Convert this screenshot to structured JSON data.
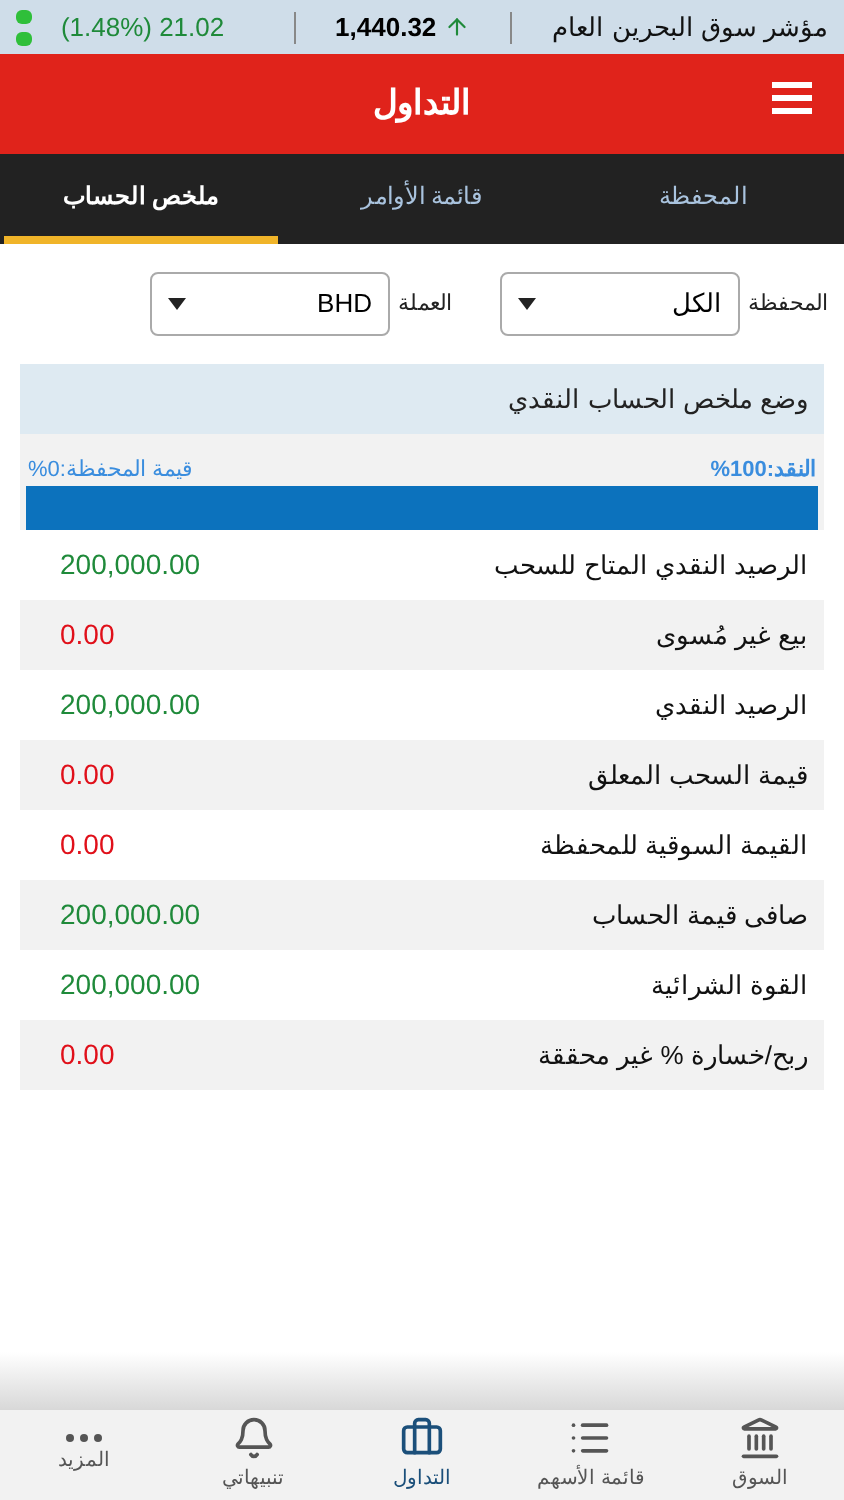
{
  "ticker": {
    "index_name": "مؤشر سوق البحرين العام",
    "value": "1,440.32",
    "up": true,
    "change": "(1.48%) 21.02"
  },
  "header": {
    "title": "التداول"
  },
  "tabs": [
    {
      "label": "المحفظة",
      "selected": false
    },
    {
      "label": "قائمة الأوامر",
      "selected": false
    },
    {
      "label": "ملخص الحساب",
      "selected": true
    }
  ],
  "filters": [
    {
      "label": "المحفظة",
      "value": "الكل"
    },
    {
      "label": "العملة",
      "value": "BHD"
    }
  ],
  "summary": {
    "title": "وضع ملخص الحساب النقدي",
    "cash_label": "النقد:100%",
    "portfolio_label": "قيمة المحفظة:0%",
    "level": 1
  },
  "rows": [
    {
      "label": "الرصيد النقدي المتاح للسحب",
      "value": "200,000.00",
      "color": "#1f8a3a"
    },
    {
      "label": "بيع غير مُسوى",
      "value": "0.00",
      "color": "#e0101a"
    },
    {
      "label": "الرصيد النقدي",
      "value": "200,000.00",
      "color": "#1f8a3a"
    },
    {
      "label": "قيمة السحب المعلق",
      "value": "0.00",
      "color": "#e0101a"
    },
    {
      "label": "القيمة السوقية للمحفظة",
      "value": "0.00",
      "color": "#e0101a"
    },
    {
      "label": "صافى قيمة الحساب",
      "value": "200,000.00",
      "color": "#1f8a3a"
    },
    {
      "label": "القوة الشرائية",
      "value": "200,000.00",
      "color": "#1f8a3a"
    },
    {
      "label": "ربح/خسارة % غير محققة",
      "value": "0.00",
      "color": "#e0101a"
    }
  ],
  "nav": [
    {
      "kind": "market",
      "label": "السوق",
      "selected": false
    },
    {
      "kind": "list",
      "label": "قائمة الأسهم",
      "selected": false
    },
    {
      "kind": "trading",
      "label": "التداول",
      "selected": true
    },
    {
      "kind": "alerts",
      "label": "تنبيهاتي",
      "selected": false
    },
    {
      "kind": "more",
      "label": "المزيد",
      "selected": false
    }
  ]
}
